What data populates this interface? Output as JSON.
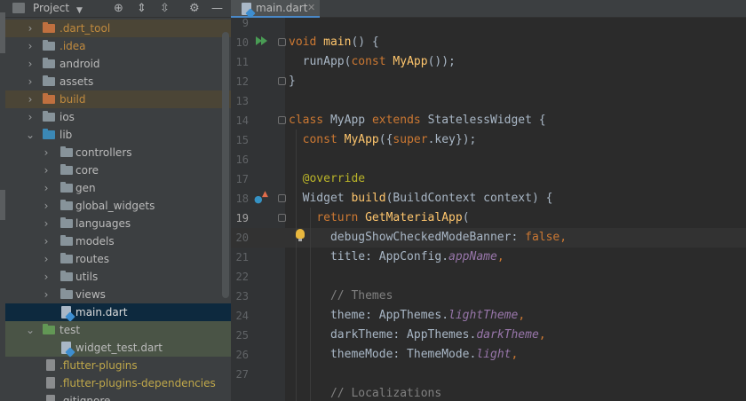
{
  "project_panel": {
    "title": "Project",
    "icons": [
      "chevron-down-icon",
      "locate-icon",
      "expand-all-icon",
      "collapse-all-icon",
      "gear-icon",
      "minimize-icon"
    ],
    "tree": [
      {
        "label": ".dart_tool",
        "kind": "folder",
        "excluded": true
      },
      {
        "label": ".idea",
        "kind": "folder",
        "excluded": true
      },
      {
        "label": "android",
        "kind": "folder"
      },
      {
        "label": "assets",
        "kind": "folder"
      },
      {
        "label": "build",
        "kind": "folder",
        "excluded": true
      },
      {
        "label": "ios",
        "kind": "folder"
      },
      {
        "label": "lib",
        "kind": "folder",
        "expanded": true
      },
      {
        "label": "controllers",
        "kind": "folder"
      },
      {
        "label": "core",
        "kind": "folder"
      },
      {
        "label": "gen",
        "kind": "folder"
      },
      {
        "label": "global_widgets",
        "kind": "folder"
      },
      {
        "label": "languages",
        "kind": "folder"
      },
      {
        "label": "models",
        "kind": "folder"
      },
      {
        "label": "routes",
        "kind": "folder"
      },
      {
        "label": "utils",
        "kind": "folder"
      },
      {
        "label": "views",
        "kind": "folder"
      },
      {
        "label": "main.dart",
        "kind": "dart-file",
        "selected": true
      },
      {
        "label": "test",
        "kind": "folder",
        "expanded": true
      },
      {
        "label": "widget_test.dart",
        "kind": "dart-file"
      },
      {
        "label": ".flutter-plugins",
        "kind": "file"
      },
      {
        "label": ".flutter-plugins-dependencies",
        "kind": "file"
      },
      {
        "label": ".gitignore",
        "kind": "file"
      }
    ]
  },
  "editor": {
    "tab": {
      "label": "main.dart",
      "close": "✕"
    },
    "lines": [
      {
        "n": "9"
      },
      {
        "n": "10"
      },
      {
        "n": "11"
      },
      {
        "n": "12"
      },
      {
        "n": "13"
      },
      {
        "n": "14"
      },
      {
        "n": "15"
      },
      {
        "n": "16"
      },
      {
        "n": "17"
      },
      {
        "n": "18"
      },
      {
        "n": "19"
      },
      {
        "n": "20"
      },
      {
        "n": "21"
      },
      {
        "n": "22"
      },
      {
        "n": "23"
      },
      {
        "n": "24"
      },
      {
        "n": "25"
      },
      {
        "n": "26"
      },
      {
        "n": "27"
      }
    ],
    "code": {
      "l9_kw": "void",
      "l9_fn": "main",
      "l9_rest": "() {",
      "l10_a": "runApp(",
      "l10_kw": "const",
      "l10_cls": "MyApp",
      "l10_rest": "());",
      "l11": "}",
      "l13_kw1": "class",
      "l13_cls": "MyApp",
      "l13_kw2": "extends",
      "l13_cls2": "StatelessWidget",
      "l13_rest": "{",
      "l14_kw": "const",
      "l14_fn": "MyApp",
      "l14_a": "({",
      "l14_kw2": "super",
      "l14_b": ".key});",
      "l16_anno": "@override",
      "l17_a": "Widget",
      "l17_fn": "build",
      "l17_rest": "(BuildContext context) {",
      "l18_kw": "return",
      "l18_fn": "GetMaterialApp",
      "l18_rest": "(",
      "l19_a": "debugShowCheckedModeBanner: ",
      "l19_kw": "false",
      "l19_rest": ",",
      "l20_a": "title: AppConfig.",
      "l20_field": "appName",
      "l20_rest": ",",
      "l22_cmt": "// Themes",
      "l23_a": "theme: AppThemes.",
      "l23_field": "lightTheme",
      "l23_rest": ",",
      "l24_a": "darkTheme: AppThemes.",
      "l24_field": "darkTheme",
      "l24_rest": ",",
      "l25_a": "themeMode: ThemeMode.",
      "l25_field": "light",
      "l25_rest": ",",
      "l27_cmt": "// Localizations"
    }
  },
  "colors": {
    "keyword": "#cc7832",
    "function": "#ffc66d",
    "field": "#9876aa",
    "annotation": "#bbb529",
    "comment": "#808080",
    "excluded_folder": "#c08a3e",
    "folder": "#87939a",
    "selection": "#0d293e"
  }
}
